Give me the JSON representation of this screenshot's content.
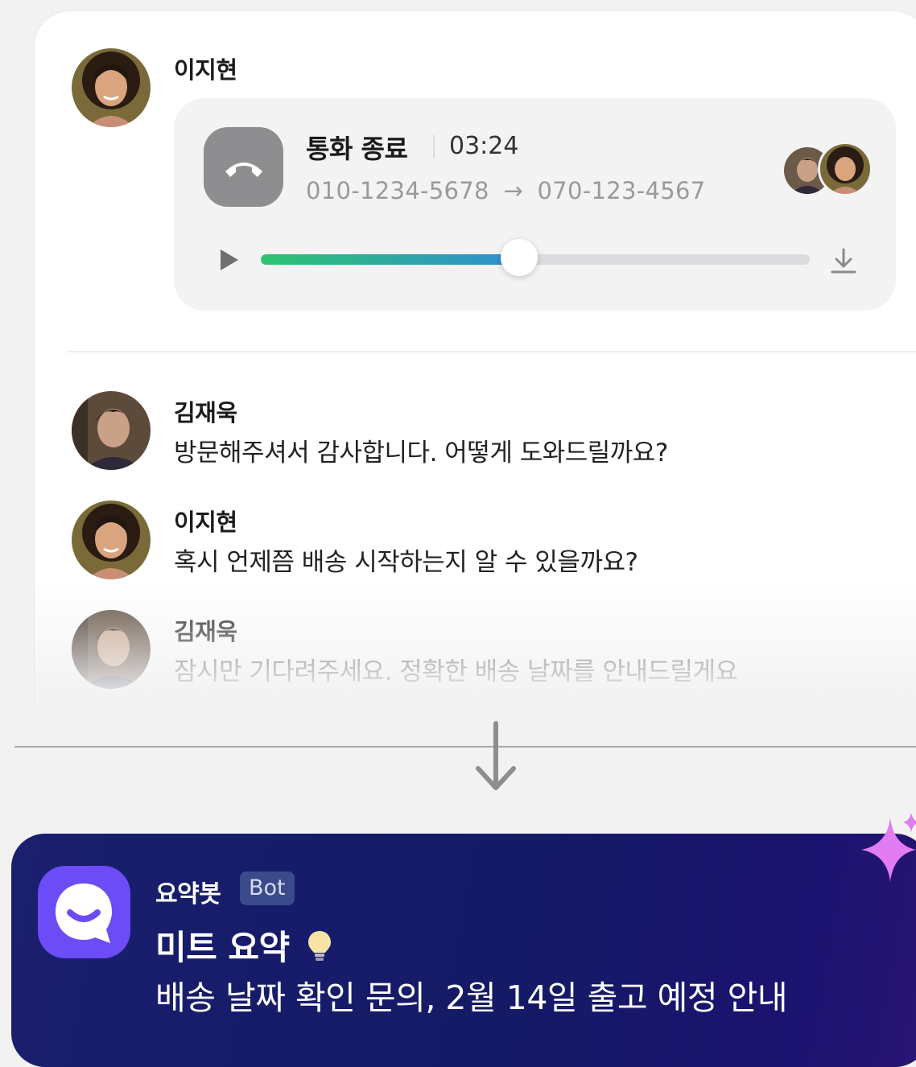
{
  "call_log": {
    "caller_name": "이지현",
    "status": "통화 종료",
    "duration": "03:24",
    "from_number": "010-1234-5678",
    "arrow": "→",
    "to_number": "070-123-4567",
    "playback_progress": 0.5
  },
  "messages": [
    {
      "name": "김재욱",
      "text": "방문해주셔서 감사합니다. 어떻게 도와드릴까요?"
    },
    {
      "name": "이지현",
      "text": "혹시 언제쯤 배송 시작하는지 알 수 있을까요?"
    },
    {
      "name": "김재욱",
      "text": "잠시만 기다려주세요. 정확한 배송 날짜를 안내드릴게요"
    }
  ],
  "summary_bot": {
    "name": "요약봇",
    "badge": "Bot",
    "title": "미트 요약",
    "title_icon": "lightbulb-icon",
    "summary": "배송 날짜 확인 문의, 2월 14일 출고 예정 안내"
  },
  "colors": {
    "accent_green": "#2ec46e",
    "accent_blue": "#2f8bd9",
    "bot_card_bg": "#141a66",
    "bot_icon_bg": "#6b4cf6",
    "sparkle": "#e27cf2"
  }
}
